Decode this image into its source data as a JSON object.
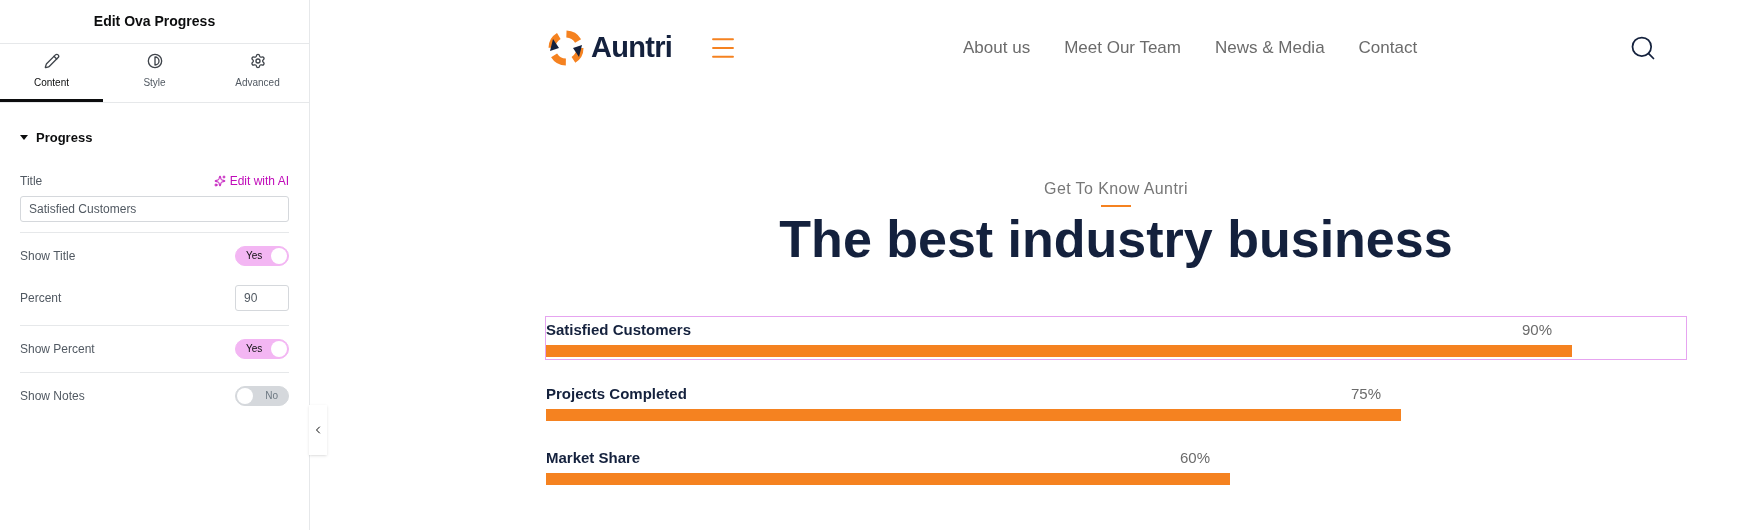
{
  "panel": {
    "title": "Edit Ova Progress",
    "tabs": [
      {
        "label": "Content",
        "selected": true
      },
      {
        "label": "Style",
        "selected": false
      },
      {
        "label": "Advanced",
        "selected": false
      }
    ],
    "section": {
      "label": "Progress",
      "expanded": true
    },
    "ai_link": "Edit with AI",
    "controls": [
      {
        "kind": "text",
        "label": "Title",
        "value": "Satisfied Customers"
      },
      {
        "kind": "toggle",
        "label": "Show Title",
        "on": true,
        "state_label": "Yes"
      },
      {
        "kind": "number",
        "label": "Percent",
        "value": "90"
      },
      {
        "kind": "toggle",
        "label": "Show Percent",
        "on": true,
        "state_label": "Yes"
      },
      {
        "kind": "toggle",
        "label": "Show Notes",
        "on": false,
        "state_label": "No"
      }
    ]
  },
  "site": {
    "logo": "Auntri",
    "nav": [
      "About us",
      "Meet Our Team",
      "News & Media",
      "Contact"
    ],
    "eyebrow": "Get To Know Auntri",
    "heading": "The best industry business",
    "bars": [
      {
        "title": "Satisfied Customers",
        "percent": "90%",
        "level": 0.9,
        "selected": true
      },
      {
        "title": "Projects Completed",
        "percent": "75%",
        "level": 0.75,
        "selected": false
      },
      {
        "title": "Market Share",
        "percent": "60%",
        "level": 0.6,
        "selected": false
      }
    ]
  }
}
